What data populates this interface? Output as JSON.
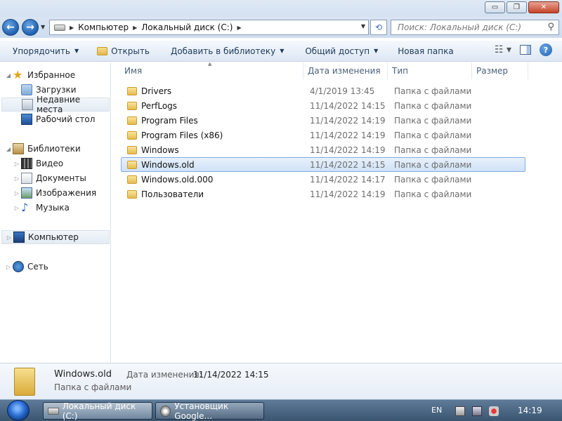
{
  "window": {
    "minimize": "▭",
    "maximize": "❐",
    "close": "✕"
  },
  "nav": {
    "back": "←",
    "forward": "→",
    "breadcrumbs": [
      "Компьютер",
      "Локальный диск (C:)"
    ],
    "search_placeholder": "Поиск: Локальный диск (C:)"
  },
  "toolbar": {
    "organize": "Упорядочить",
    "open": "Открыть",
    "add_to_library": "Добавить в библиотеку",
    "share": "Общий доступ",
    "new_folder": "Новая папка"
  },
  "sidebar": {
    "favorites": "Избранное",
    "downloads": "Загрузки",
    "recent": "Недавние места",
    "desktop": "Рабочий стол",
    "libraries": "Библиотеки",
    "videos": "Видео",
    "documents": "Документы",
    "pictures": "Изображения",
    "music": "Музыка",
    "computer": "Компьютер",
    "network": "Сеть"
  },
  "columns": {
    "name": "Имя",
    "date": "Дата изменения",
    "type": "Тип",
    "size": "Размер"
  },
  "files": [
    {
      "name": "Drivers",
      "date": "4/1/2019 13:45",
      "type": "Папка с файлами"
    },
    {
      "name": "PerfLogs",
      "date": "11/14/2022 14:15",
      "type": "Папка с файлами"
    },
    {
      "name": "Program Files",
      "date": "11/14/2022 14:19",
      "type": "Папка с файлами"
    },
    {
      "name": "Program Files (x86)",
      "date": "11/14/2022 14:19",
      "type": "Папка с файлами"
    },
    {
      "name": "Windows",
      "date": "11/14/2022 14:19",
      "type": "Папка с файлами"
    },
    {
      "name": "Windows.old",
      "date": "11/14/2022 14:15",
      "type": "Папка с файлами",
      "selected": true
    },
    {
      "name": "Windows.old.000",
      "date": "11/14/2022 14:17",
      "type": "Папка с файлами"
    },
    {
      "name": "Пользователи",
      "date": "11/14/2022 14:19",
      "type": "Папка с файлами"
    }
  ],
  "details": {
    "name": "Windows.old",
    "type": "Папка с файлами",
    "date_label": "Дата изменения:",
    "date_value": "11/14/2022 14:15"
  },
  "taskbar": {
    "task1": "Локальный диск (C:)",
    "task2": "Установщик Google...",
    "lang": "EN",
    "clock": "14:19"
  }
}
